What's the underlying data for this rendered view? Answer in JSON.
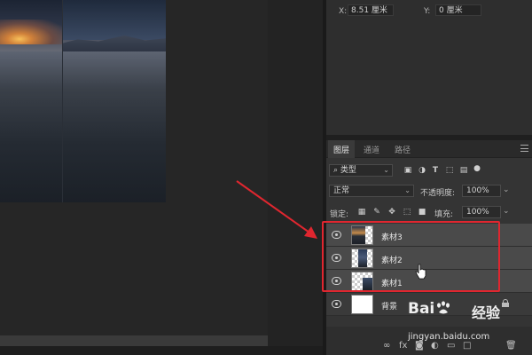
{
  "properties": {
    "x_label": "X:",
    "x_value": "8.51 厘米",
    "y_label": "Y:",
    "y_value": "0 厘米"
  },
  "layers_panel": {
    "tabs": [
      {
        "label": "图层",
        "active": true
      },
      {
        "label": "通道",
        "active": false
      },
      {
        "label": "路径",
        "active": false
      }
    ],
    "filter_kind": "类型",
    "blend_mode": "正常",
    "opacity_label": "不透明度:",
    "opacity_value": "100%",
    "lock_label": "锁定:",
    "fill_label": "填充:",
    "fill_value": "100%",
    "layers": [
      {
        "name": "素材3",
        "selected": true,
        "visible": true
      },
      {
        "name": "素材2",
        "selected": true,
        "visible": true
      },
      {
        "name": "素材1",
        "selected": true,
        "visible": true
      },
      {
        "name": "背景",
        "selected": false,
        "visible": true,
        "locked": true
      }
    ]
  },
  "icons": {
    "filter": "search-icon",
    "visibility": "eye-icon",
    "lock": "lock-icon",
    "link": "link-icon",
    "trash": "trash-icon"
  },
  "watermark": {
    "brand_prefix": "Bai",
    "brand_suffix": "经验",
    "url": "jingyan.baidu.com"
  },
  "colors": {
    "highlight": "#e0262f",
    "panel_bg": "#343434",
    "selected_row": "#4a4a4a"
  }
}
